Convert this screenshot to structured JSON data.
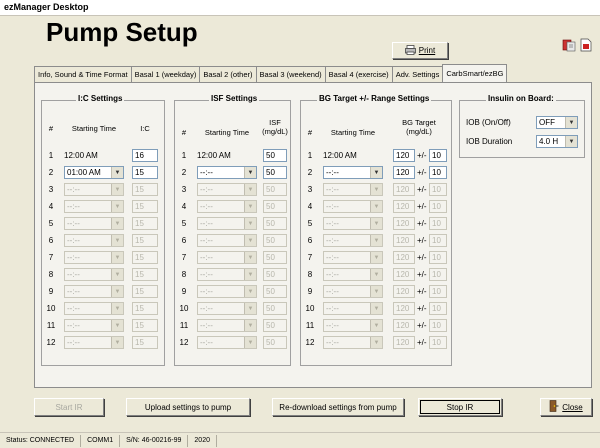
{
  "window": {
    "title": "ezManager Desktop"
  },
  "page": {
    "title": "Pump Setup"
  },
  "toolbar": {
    "print_label": "Print"
  },
  "tabs": [
    {
      "label": "Info, Sound & Time Format",
      "active": false
    },
    {
      "label": "Basal 1 (weekday)",
      "active": false
    },
    {
      "label": "Basal 2 (other)",
      "active": false
    },
    {
      "label": "Basal 3 (weekend)",
      "active": false
    },
    {
      "label": "Basal 4 (exercise)",
      "active": false
    },
    {
      "label": "Adv. Settings",
      "active": false
    },
    {
      "label": "CarbSmart/ezBG",
      "active": true
    }
  ],
  "ic": {
    "title": "I:C Settings",
    "col_num": "#",
    "col_time": "Starting Time",
    "col_val": "I:C",
    "rows": [
      {
        "n": "1",
        "time": "12:00 AM",
        "val": "16",
        "enabled": true,
        "fixed": true
      },
      {
        "n": "2",
        "time": "01:00 AM",
        "val": "15",
        "enabled": true
      },
      {
        "n": "3",
        "time": "--:--",
        "val": "15",
        "enabled": false,
        "half": true
      },
      {
        "n": "4",
        "time": "--:--",
        "val": "15",
        "enabled": false
      },
      {
        "n": "5",
        "time": "--:--",
        "val": "15",
        "enabled": false
      },
      {
        "n": "6",
        "time": "--:--",
        "val": "15",
        "enabled": false
      },
      {
        "n": "7",
        "time": "--:--",
        "val": "15",
        "enabled": false
      },
      {
        "n": "8",
        "time": "--:--",
        "val": "15",
        "enabled": false
      },
      {
        "n": "9",
        "time": "--:--",
        "val": "15",
        "enabled": false
      },
      {
        "n": "10",
        "time": "--:--",
        "val": "15",
        "enabled": false
      },
      {
        "n": "11",
        "time": "--:--",
        "val": "15",
        "enabled": false
      },
      {
        "n": "12",
        "time": "--:--",
        "val": "15",
        "enabled": false
      }
    ]
  },
  "isf": {
    "title": "ISF Settings",
    "col_num": "#",
    "col_time": "Starting Time",
    "col_val_1": "ISF",
    "col_val_2": "(mg/dL)",
    "rows": [
      {
        "n": "1",
        "time": "12:00 AM",
        "val": "50",
        "enabled": true,
        "fixed": true
      },
      {
        "n": "2",
        "time": "--:--",
        "val": "50",
        "enabled": true
      },
      {
        "n": "3",
        "time": "--:--",
        "val": "50",
        "enabled": false
      },
      {
        "n": "4",
        "time": "--:--",
        "val": "50",
        "enabled": false
      },
      {
        "n": "5",
        "time": "--:--",
        "val": "50",
        "enabled": false
      },
      {
        "n": "6",
        "time": "--:--",
        "val": "50",
        "enabled": false
      },
      {
        "n": "7",
        "time": "--:--",
        "val": "50",
        "enabled": false
      },
      {
        "n": "8",
        "time": "--:--",
        "val": "50",
        "enabled": false
      },
      {
        "n": "9",
        "time": "--:--",
        "val": "50",
        "enabled": false
      },
      {
        "n": "10",
        "time": "--:--",
        "val": "50",
        "enabled": false
      },
      {
        "n": "11",
        "time": "--:--",
        "val": "50",
        "enabled": false
      },
      {
        "n": "12",
        "time": "--:--",
        "val": "50",
        "enabled": false
      }
    ]
  },
  "bg": {
    "title": "BG Target +/- Range Settings",
    "col_num": "#",
    "col_time": "Starting Time",
    "col_val_1": "BG Target",
    "col_val_2": "(mg/dL)",
    "pm": "+/-",
    "rows": [
      {
        "n": "1",
        "time": "12:00 AM",
        "target": "120",
        "range": "10",
        "enabled": true,
        "fixed": true
      },
      {
        "n": "2",
        "time": "--:--",
        "target": "120",
        "range": "10",
        "enabled": true
      },
      {
        "n": "3",
        "time": "--:--",
        "target": "120",
        "range": "10",
        "enabled": false
      },
      {
        "n": "4",
        "time": "--:--",
        "target": "120",
        "range": "10",
        "enabled": false
      },
      {
        "n": "5",
        "time": "--:--",
        "target": "120",
        "range": "10",
        "enabled": false
      },
      {
        "n": "6",
        "time": "--:--",
        "target": "120",
        "range": "10",
        "enabled": false
      },
      {
        "n": "7",
        "time": "--:--",
        "target": "120",
        "range": "10",
        "enabled": false
      },
      {
        "n": "8",
        "time": "--:--",
        "target": "120",
        "range": "10",
        "enabled": false
      },
      {
        "n": "9",
        "time": "--:--",
        "target": "120",
        "range": "10",
        "enabled": false
      },
      {
        "n": "10",
        "time": "--:--",
        "target": "120",
        "range": "10",
        "enabled": false
      },
      {
        "n": "11",
        "time": "--:--",
        "target": "120",
        "range": "10",
        "enabled": false
      },
      {
        "n": "12",
        "time": "--:--",
        "target": "120",
        "range": "10",
        "enabled": false
      }
    ]
  },
  "iob": {
    "title": "Insulin on Board:",
    "onoff_label": "IOB (On/Off)",
    "onoff_value": "OFF",
    "duration_label": "IOB Duration",
    "duration_value": "4.0 H"
  },
  "buttons": {
    "start_ir": "Start IR",
    "upload": "Upload settings to pump",
    "redownload": "Re-download settings from pump",
    "stop_ir": "Stop IR",
    "close": "Close"
  },
  "status": {
    "connection": "Status: CONNECTED",
    "port": "COMM1",
    "serial": "S/N: 46-00216-99",
    "year": "2020"
  },
  "icons": {
    "print": "printer-icon",
    "close": "door-exit-icon",
    "tool1": "export-icon",
    "tool2": "document-icon"
  }
}
